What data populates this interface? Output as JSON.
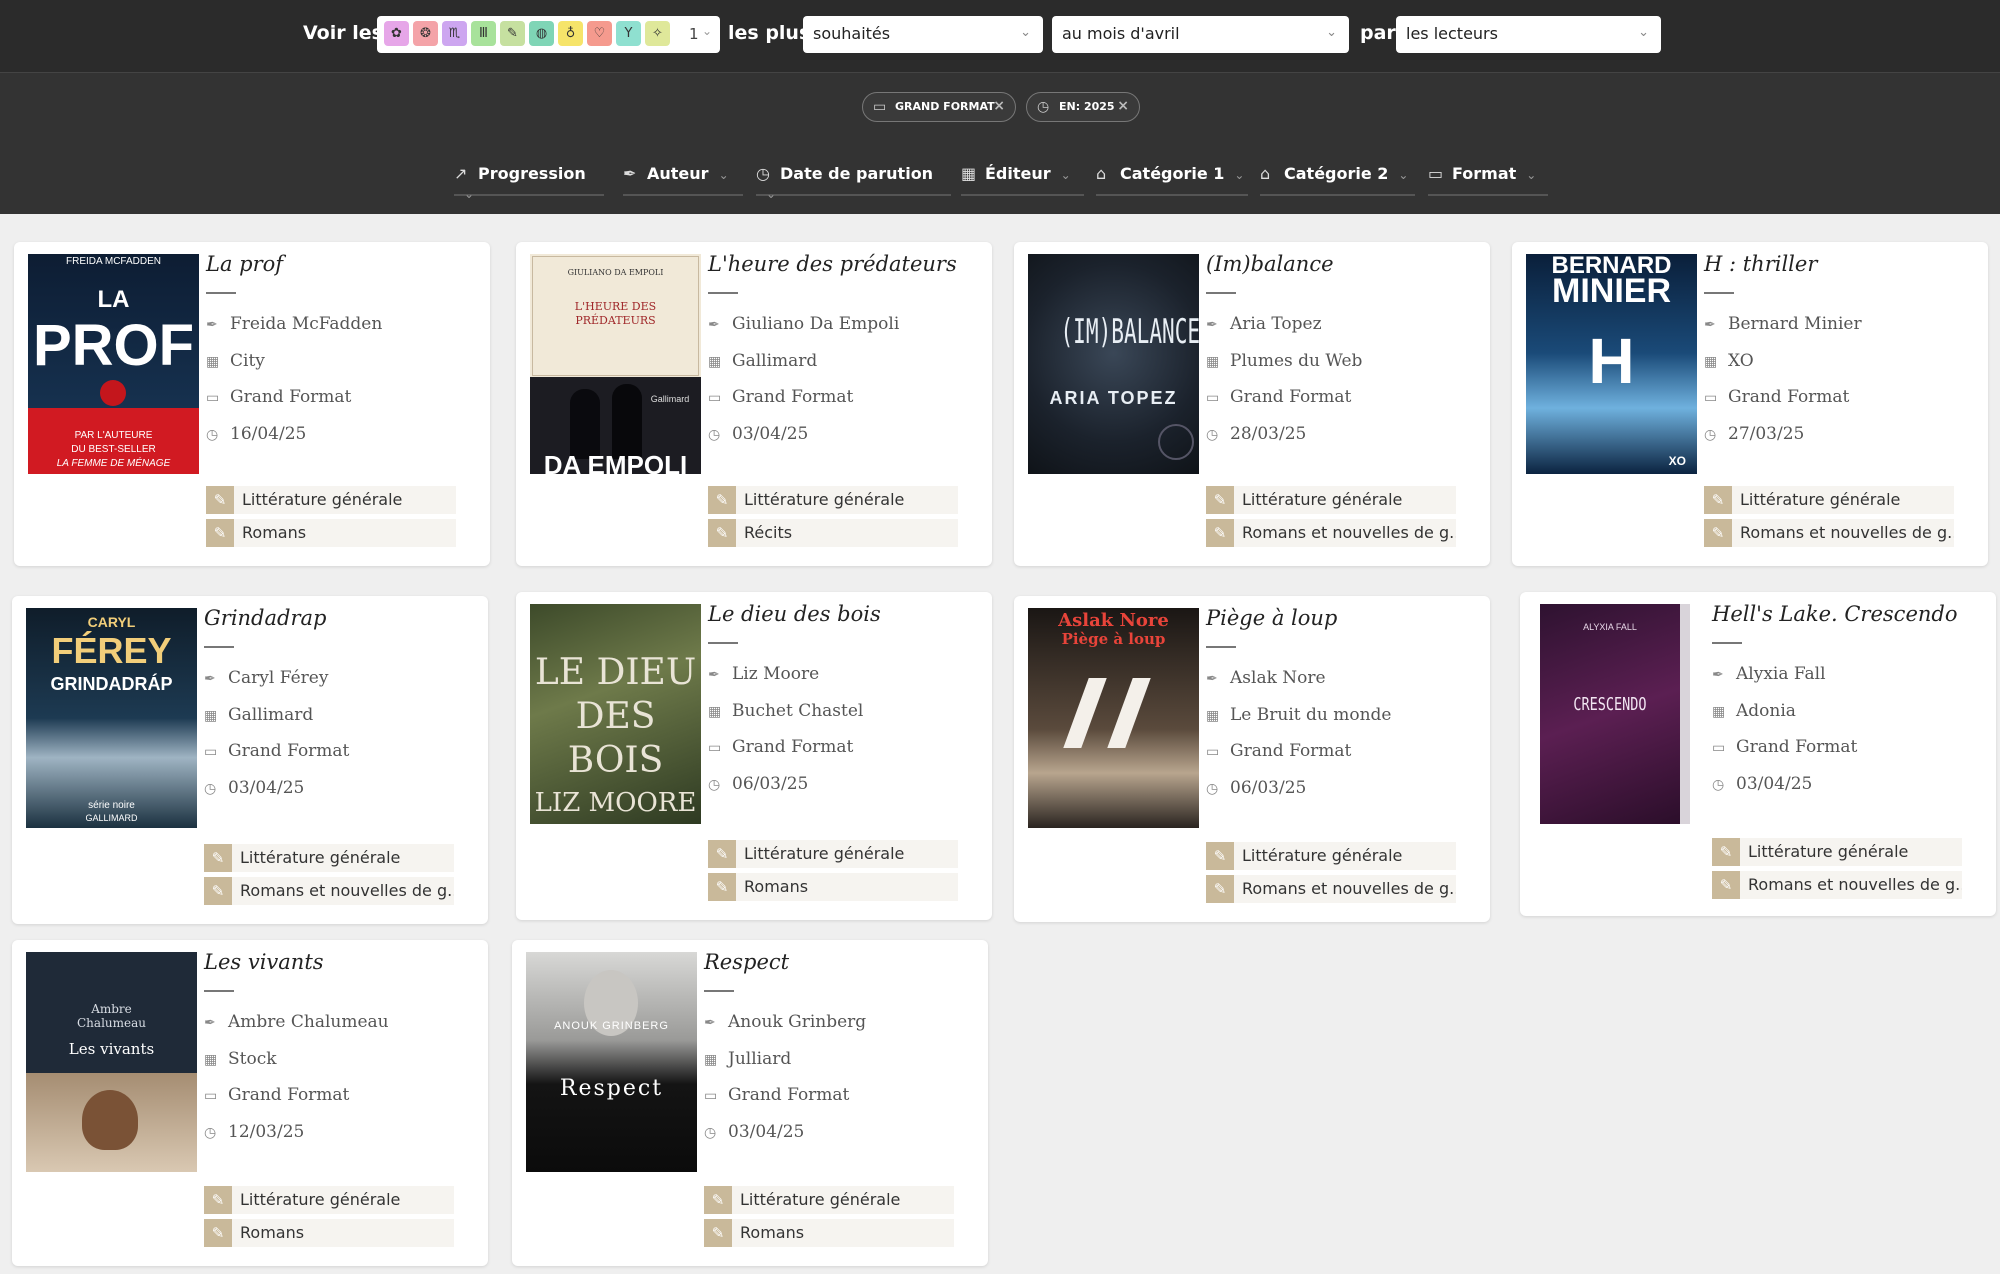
{
  "header": {
    "see_label": "Voir les",
    "count_value": "1",
    "most_label": "les plus",
    "by_label": "par",
    "select_ranking": "souhaités",
    "select_period": "au mois d'avril",
    "select_by": "les lecteurs",
    "category_icons": [
      "flower-icon",
      "brain-icon",
      "scorpio-icon",
      "columns-icon",
      "feather-icon",
      "globe-icon",
      "bulb-icon",
      "heart-icon",
      "cocktail-icon",
      "sparkle-icon"
    ]
  },
  "filters": [
    {
      "label": "GRAND FORMAT",
      "icon": "book-icon"
    },
    {
      "label": "EN: 2025",
      "icon": "clock-icon"
    }
  ],
  "sort": [
    {
      "label": "Progression",
      "icon": "chart-icon"
    },
    {
      "label": "Auteur",
      "icon": "pen-icon"
    },
    {
      "label": "Date de parution",
      "icon": "clock-icon"
    },
    {
      "label": "Éditeur",
      "icon": "building-icon"
    },
    {
      "label": "Catégorie 1",
      "icon": "tag-icon"
    },
    {
      "label": "Catégorie 2",
      "icon": "tag-icon"
    },
    {
      "label": "Format",
      "icon": "book-icon"
    }
  ],
  "books": [
    {
      "title": "La prof",
      "author": "Freida McFadden",
      "publisher": "City",
      "format": "Grand Format",
      "date": "16/04/25",
      "cat1": "Littérature générale",
      "cat2": "Romans",
      "cover_lines": [
        "FREIDA MCFADDEN",
        "LA",
        "PROF",
        "PAR L'AUTEURE",
        "DU BEST-SELLER",
        "LA FEMME DE MÉNAGE"
      ]
    },
    {
      "title": "L'heure des prédateurs",
      "author": "Giuliano Da Empoli",
      "publisher": "Gallimard",
      "format": "Grand Format",
      "date": "03/04/25",
      "cat1": "Littérature générale",
      "cat2": "Récits",
      "cover_lines": [
        "GIULIANO DA EMPOLI",
        "L'HEURE DES",
        "PRÉDATEURS",
        "Gallimard",
        "DA EMPOLI"
      ]
    },
    {
      "title": "(Im)balance",
      "author": "Aria Topez",
      "publisher": "Plumes du Web",
      "format": "Grand Format",
      "date": "28/03/25",
      "cat1": "Littérature générale",
      "cat2": "Romans et nouvelles de g...",
      "cover_lines": [
        "(IM)BALANCE",
        "ARIA TOPEZ"
      ]
    },
    {
      "title": "H : thriller",
      "author": "Bernard Minier",
      "publisher": "XO",
      "format": "Grand Format",
      "date": "27/03/25",
      "cat1": "Littérature générale",
      "cat2": "Romans et nouvelles de g...",
      "cover_lines": [
        "BERNARD",
        "MINIER",
        "H",
        "XO"
      ]
    },
    {
      "title": "Grindadrap",
      "author": "Caryl Férey",
      "publisher": "Gallimard",
      "format": "Grand Format",
      "date": "03/04/25",
      "cat1": "Littérature générale",
      "cat2": "Romans et nouvelles de g...",
      "cover_lines": [
        "CARYL",
        "FÉREY",
        "GRINDADRÁP",
        "série noire",
        "GALLIMARD"
      ]
    },
    {
      "title": "Le dieu des bois",
      "author": "Liz Moore",
      "publisher": "Buchet Chastel",
      "format": "Grand Format",
      "date": "06/03/25",
      "cat1": "Littérature générale",
      "cat2": "Romans",
      "cover_lines": [
        "LE DIEU",
        "DES",
        "BOIS",
        "LIZ MOORE"
      ]
    },
    {
      "title": "Piège à loup",
      "author": "Aslak Nore",
      "publisher": "Le Bruit du monde",
      "format": "Grand Format",
      "date": "06/03/25",
      "cat1": "Littérature générale",
      "cat2": "Romans et nouvelles de g...",
      "cover_lines": [
        "Aslak Nore",
        "Piège à loup"
      ]
    },
    {
      "title": "Hell's Lake. Crescendo",
      "author": "Alyxia Fall",
      "publisher": "Adonia",
      "format": "Grand Format",
      "date": "03/04/25",
      "cat1": "Littérature générale",
      "cat2": "Romans et nouvelles de g...",
      "cover_lines": [
        "ALYXIA FALL",
        "CRESCENDO"
      ]
    },
    {
      "title": "Les vivants",
      "author": "Ambre Chalumeau",
      "publisher": "Stock",
      "format": "Grand Format",
      "date": "12/03/25",
      "cat1": "Littérature générale",
      "cat2": "Romans",
      "cover_lines": [
        "Ambre",
        "Chalumeau",
        "Les vivants"
      ]
    },
    {
      "title": "Respect",
      "author": "Anouk Grinberg",
      "publisher": "Julliard",
      "format": "Grand Format",
      "date": "03/04/25",
      "cat1": "Littérature générale",
      "cat2": "Romans",
      "cover_lines": [
        "ANOUK GRINBERG",
        "Respect"
      ]
    }
  ],
  "colors": {
    "topbar": "#2b2b2b",
    "filterband": "#333333",
    "tag_icon": "#c9b99a",
    "tag_bg": "#f6f4f0"
  }
}
